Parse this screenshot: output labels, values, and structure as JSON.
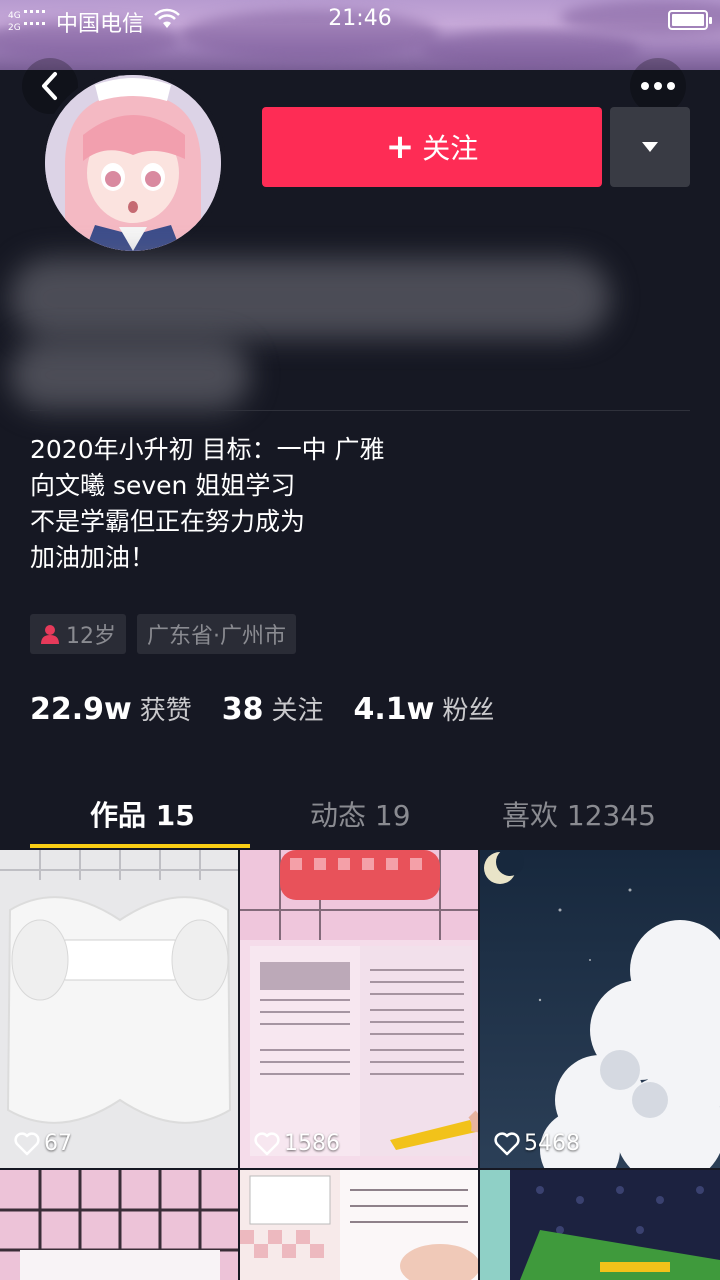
{
  "status_bar": {
    "network": "4G 2G",
    "carrier": "中国电信",
    "time": "21:46"
  },
  "header": {
    "follow_label": "关注"
  },
  "bio": {
    "lines": [
      "2020年小升初  目标：一中 广雅",
      "向文曦 seven 姐姐学习",
      "不是学霸但正在努力成为",
      "加油加油！"
    ]
  },
  "tags": {
    "age": "12岁",
    "location": "广东省·广州市"
  },
  "stats": {
    "likes_num": "22.9w",
    "likes_label": "获赞",
    "following_num": "38",
    "following_label": "关注",
    "followers_num": "4.1w",
    "followers_label": "粉丝"
  },
  "tabs": [
    {
      "label": "作品 15",
      "active": true
    },
    {
      "label": "动态 19",
      "active": false
    },
    {
      "label": "喜欢 12345",
      "active": false
    }
  ],
  "videos": [
    {
      "likes": "67"
    },
    {
      "likes": "1586"
    },
    {
      "likes": "5468"
    }
  ],
  "colors": {
    "background": "#161823",
    "follow": "#fe2c55",
    "tab_indicator": "#face15"
  }
}
